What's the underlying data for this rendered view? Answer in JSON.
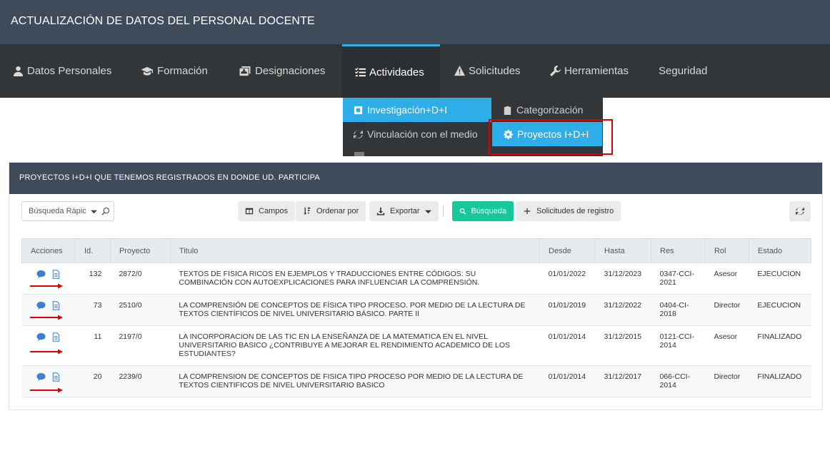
{
  "app": {
    "title": "ACTUALIZACIÓN DE DATOS DEL PERSONAL DOCENTE"
  },
  "nav": {
    "items": [
      {
        "label": "Datos Personales",
        "icon": "user-icon"
      },
      {
        "label": "Formación",
        "icon": "graduation-cap-icon"
      },
      {
        "label": "Designaciones",
        "icon": "id-card-icon"
      },
      {
        "label": "Actividades",
        "icon": "tasks-icon"
      },
      {
        "label": "Solicitudes",
        "icon": "warning-icon"
      },
      {
        "label": "Herramientas",
        "icon": "wrench-icon"
      },
      {
        "label": "Seguridad",
        "icon": ""
      }
    ],
    "active": "Actividades"
  },
  "dropdown": {
    "items": [
      {
        "label": "Investigación+D+I",
        "icon": "square-icon"
      },
      {
        "label": "Categorización",
        "icon": "clipboard-icon"
      },
      {
        "label": "Vinculación con el medio",
        "icon": "refresh-icon"
      },
      {
        "label": "Proyectos I+D+I",
        "icon": "gear-icon"
      }
    ]
  },
  "panel": {
    "title": "PROYECTOS I+D+I QUE TENEMOS REGISTRADOS EN DONDE UD. PARTICIPA",
    "search_placeholder": "Búsqueda Rápic",
    "toolbar": {
      "fields": "Campos",
      "sort": "Ordenar por",
      "export": "Exportar",
      "search": "Búsqueda",
      "requests": "Solicitudes de registro"
    }
  },
  "table": {
    "headers": [
      "Acciones",
      "Id.",
      "Proyecto",
      "Titulo",
      "Desde",
      "Hasta",
      "Res",
      "Rol",
      "Estado"
    ],
    "rows": [
      {
        "id": "132",
        "proyecto": "2872/0",
        "titulo": "TEXTOS DE FISICA RICOS EN EJEMPLOS Y TRADUCCIONES ENTRE CÓDIGOS: SU COMBINACIÓN CON AUTOEXPLICACIONES PARA INFLUENCIAR LA COMPRENSIÓN.",
        "desde": "01/01/2022",
        "hasta": "31/12/2023",
        "res": "0347-CCI-2021",
        "rol": "Asesor",
        "estado": "EJECUCION"
      },
      {
        "id": "73",
        "proyecto": "2510/0",
        "titulo": "LA COMPRENSIÓN DE CONCEPTOS DE FÍSICA TIPO PROCESO. POR MEDIO DE LA LECTURA DE TEXTOS CIENTÍFICOS DE NIVEL UNIVERSITARIO BÁSICO. PARTE II",
        "desde": "01/01/2019",
        "hasta": "31/12/2022",
        "res": "0404-CI-2018",
        "rol": "Director",
        "estado": "EJECUCION"
      },
      {
        "id": "11",
        "proyecto": "2197/0",
        "titulo": "LA INCORPORACION DE LAS TIC EN LA ENSEÑANZA DE LA MATEMATICA EN EL NIVEL UNIVERSITARIO BASICO ¿CONTRIBUYE A MEJORAR EL RENDIMIENTO ACADEMICO DE LOS ESTUDIANTES?",
        "desde": "01/01/2014",
        "hasta": "31/12/2015",
        "res": "0121-CCI-2014",
        "rol": "Asesor",
        "estado": "FINALIZADO"
      },
      {
        "id": "20",
        "proyecto": "2239/0",
        "titulo": "LA COMPRENSION DE CONCEPTOS DE FISICA TIPO PROCESO POR MEDIO DE LA LECTURA DE TEXTOS CIENTIFICOS DE NIVEL UNIVERSITARIO BASICO",
        "desde": "01/01/2014",
        "hasta": "31/12/2017",
        "res": "066-CCI-2014",
        "rol": "Director",
        "estado": "FINALIZADO"
      }
    ]
  },
  "colors": {
    "header": "#3f4b5a",
    "nav": "#333638",
    "accent": "#34b1e5",
    "green": "#18c79b",
    "annotation": "#e00000"
  }
}
